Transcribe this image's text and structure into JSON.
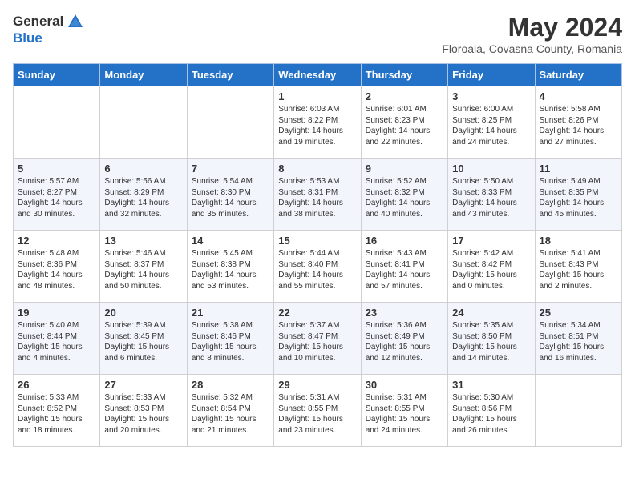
{
  "header": {
    "logo_general": "General",
    "logo_blue": "Blue",
    "month_year": "May 2024",
    "location": "Floroaia, Covasna County, Romania"
  },
  "days_of_week": [
    "Sunday",
    "Monday",
    "Tuesday",
    "Wednesday",
    "Thursday",
    "Friday",
    "Saturday"
  ],
  "weeks": [
    [
      {
        "day": "",
        "info": ""
      },
      {
        "day": "",
        "info": ""
      },
      {
        "day": "",
        "info": ""
      },
      {
        "day": "1",
        "info": "Sunrise: 6:03 AM\nSunset: 8:22 PM\nDaylight: 14 hours\nand 19 minutes."
      },
      {
        "day": "2",
        "info": "Sunrise: 6:01 AM\nSunset: 8:23 PM\nDaylight: 14 hours\nand 22 minutes."
      },
      {
        "day": "3",
        "info": "Sunrise: 6:00 AM\nSunset: 8:25 PM\nDaylight: 14 hours\nand 24 minutes."
      },
      {
        "day": "4",
        "info": "Sunrise: 5:58 AM\nSunset: 8:26 PM\nDaylight: 14 hours\nand 27 minutes."
      }
    ],
    [
      {
        "day": "5",
        "info": "Sunrise: 5:57 AM\nSunset: 8:27 PM\nDaylight: 14 hours\nand 30 minutes."
      },
      {
        "day": "6",
        "info": "Sunrise: 5:56 AM\nSunset: 8:29 PM\nDaylight: 14 hours\nand 32 minutes."
      },
      {
        "day": "7",
        "info": "Sunrise: 5:54 AM\nSunset: 8:30 PM\nDaylight: 14 hours\nand 35 minutes."
      },
      {
        "day": "8",
        "info": "Sunrise: 5:53 AM\nSunset: 8:31 PM\nDaylight: 14 hours\nand 38 minutes."
      },
      {
        "day": "9",
        "info": "Sunrise: 5:52 AM\nSunset: 8:32 PM\nDaylight: 14 hours\nand 40 minutes."
      },
      {
        "day": "10",
        "info": "Sunrise: 5:50 AM\nSunset: 8:33 PM\nDaylight: 14 hours\nand 43 minutes."
      },
      {
        "day": "11",
        "info": "Sunrise: 5:49 AM\nSunset: 8:35 PM\nDaylight: 14 hours\nand 45 minutes."
      }
    ],
    [
      {
        "day": "12",
        "info": "Sunrise: 5:48 AM\nSunset: 8:36 PM\nDaylight: 14 hours\nand 48 minutes."
      },
      {
        "day": "13",
        "info": "Sunrise: 5:46 AM\nSunset: 8:37 PM\nDaylight: 14 hours\nand 50 minutes."
      },
      {
        "day": "14",
        "info": "Sunrise: 5:45 AM\nSunset: 8:38 PM\nDaylight: 14 hours\nand 53 minutes."
      },
      {
        "day": "15",
        "info": "Sunrise: 5:44 AM\nSunset: 8:40 PM\nDaylight: 14 hours\nand 55 minutes."
      },
      {
        "day": "16",
        "info": "Sunrise: 5:43 AM\nSunset: 8:41 PM\nDaylight: 14 hours\nand 57 minutes."
      },
      {
        "day": "17",
        "info": "Sunrise: 5:42 AM\nSunset: 8:42 PM\nDaylight: 15 hours\nand 0 minutes."
      },
      {
        "day": "18",
        "info": "Sunrise: 5:41 AM\nSunset: 8:43 PM\nDaylight: 15 hours\nand 2 minutes."
      }
    ],
    [
      {
        "day": "19",
        "info": "Sunrise: 5:40 AM\nSunset: 8:44 PM\nDaylight: 15 hours\nand 4 minutes."
      },
      {
        "day": "20",
        "info": "Sunrise: 5:39 AM\nSunset: 8:45 PM\nDaylight: 15 hours\nand 6 minutes."
      },
      {
        "day": "21",
        "info": "Sunrise: 5:38 AM\nSunset: 8:46 PM\nDaylight: 15 hours\nand 8 minutes."
      },
      {
        "day": "22",
        "info": "Sunrise: 5:37 AM\nSunset: 8:47 PM\nDaylight: 15 hours\nand 10 minutes."
      },
      {
        "day": "23",
        "info": "Sunrise: 5:36 AM\nSunset: 8:49 PM\nDaylight: 15 hours\nand 12 minutes."
      },
      {
        "day": "24",
        "info": "Sunrise: 5:35 AM\nSunset: 8:50 PM\nDaylight: 15 hours\nand 14 minutes."
      },
      {
        "day": "25",
        "info": "Sunrise: 5:34 AM\nSunset: 8:51 PM\nDaylight: 15 hours\nand 16 minutes."
      }
    ],
    [
      {
        "day": "26",
        "info": "Sunrise: 5:33 AM\nSunset: 8:52 PM\nDaylight: 15 hours\nand 18 minutes."
      },
      {
        "day": "27",
        "info": "Sunrise: 5:33 AM\nSunset: 8:53 PM\nDaylight: 15 hours\nand 20 minutes."
      },
      {
        "day": "28",
        "info": "Sunrise: 5:32 AM\nSunset: 8:54 PM\nDaylight: 15 hours\nand 21 minutes."
      },
      {
        "day": "29",
        "info": "Sunrise: 5:31 AM\nSunset: 8:55 PM\nDaylight: 15 hours\nand 23 minutes."
      },
      {
        "day": "30",
        "info": "Sunrise: 5:31 AM\nSunset: 8:55 PM\nDaylight: 15 hours\nand 24 minutes."
      },
      {
        "day": "31",
        "info": "Sunrise: 5:30 AM\nSunset: 8:56 PM\nDaylight: 15 hours\nand 26 minutes."
      },
      {
        "day": "",
        "info": ""
      }
    ]
  ]
}
